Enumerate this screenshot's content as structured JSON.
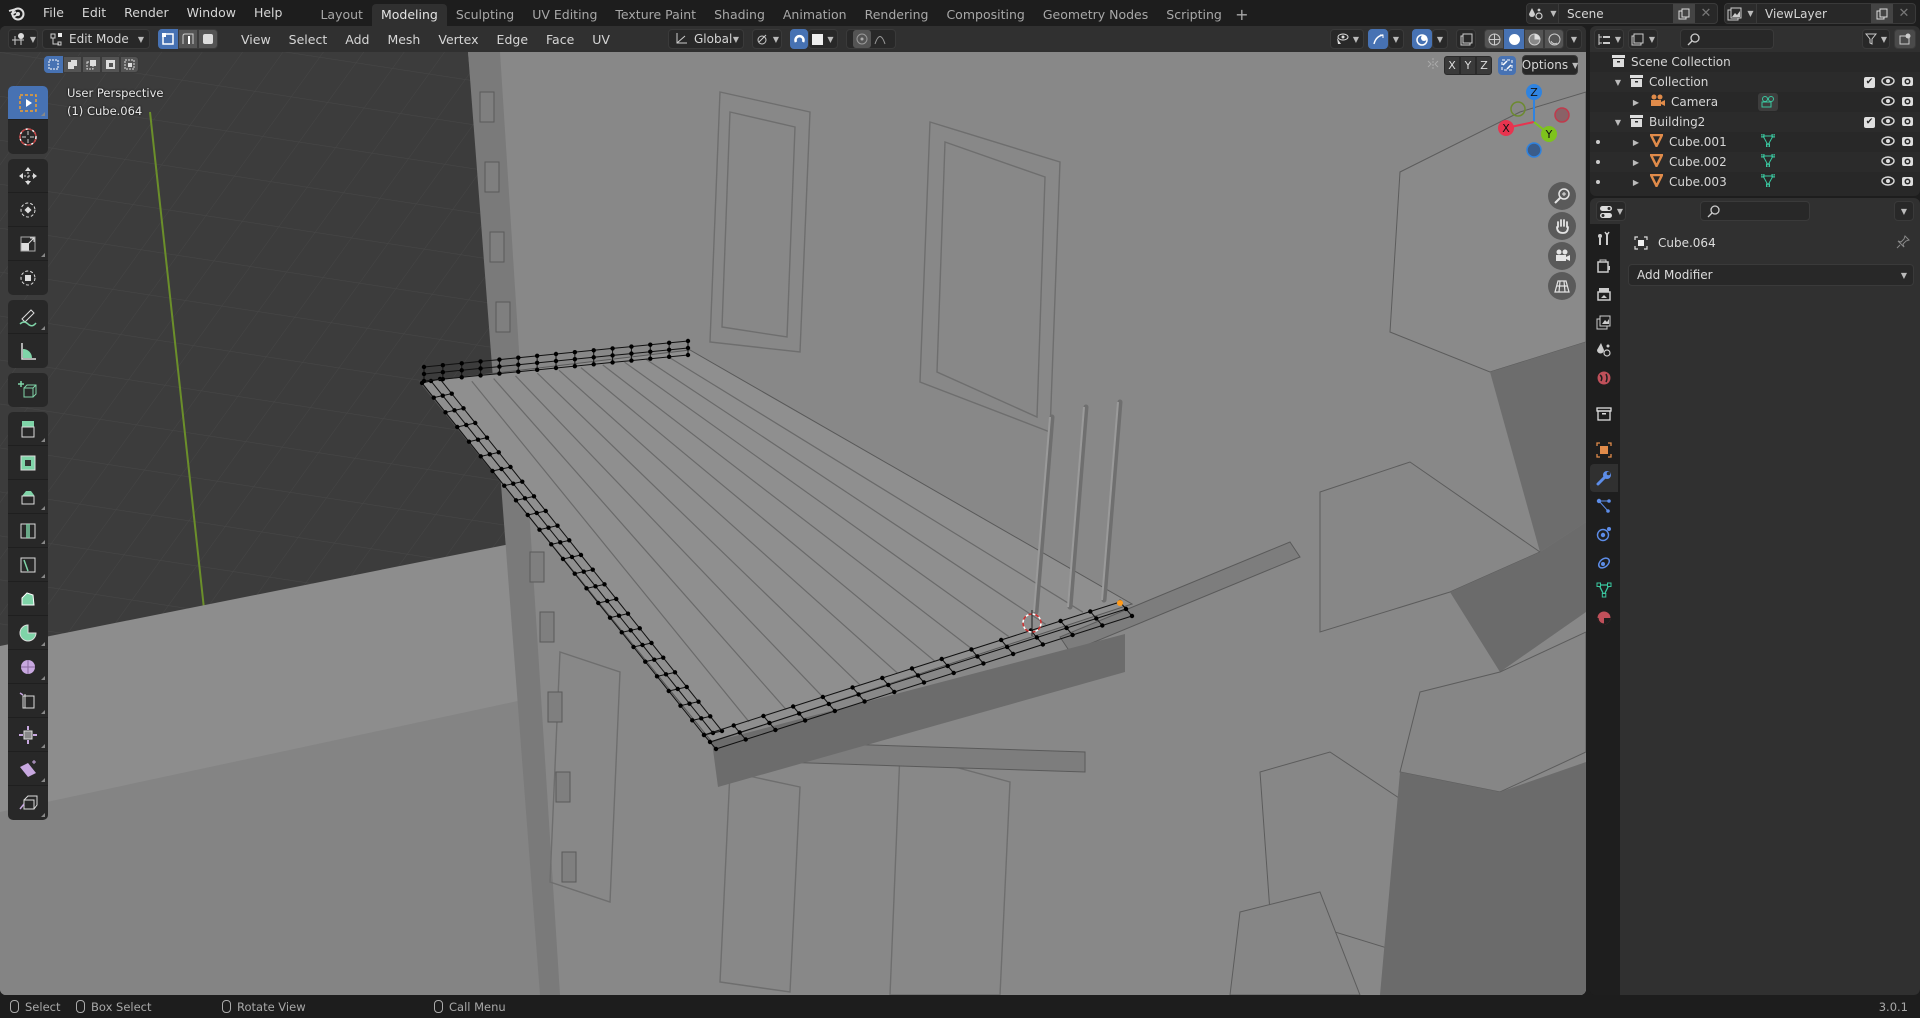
{
  "app": {
    "menus": [
      "File",
      "Edit",
      "Render",
      "Window",
      "Help"
    ],
    "workspaces": [
      "Layout",
      "Modeling",
      "Sculpting",
      "UV Editing",
      "Texture Paint",
      "Shading",
      "Animation",
      "Rendering",
      "Compositing",
      "Geometry Nodes",
      "Scripting"
    ],
    "active_workspace": "Modeling",
    "add_workspace": "+",
    "scene_name": "Scene",
    "view_layer_name": "ViewLayer",
    "version": "3.0.1"
  },
  "viewport_header": {
    "mode": "Edit Mode",
    "menus": [
      "View",
      "Select",
      "Add",
      "Mesh",
      "Vertex",
      "Edge",
      "Face",
      "UV"
    ],
    "transform_orientation": "Global",
    "options_label": "Options",
    "axes": [
      "X",
      "Y",
      "Z"
    ],
    "select_mode_active": "vertex",
    "shading_mode_active": "solid"
  },
  "viewport": {
    "view_name": "User Perspective",
    "object_info": "(1) Cube.064",
    "gizmo_axes": {
      "x": "X",
      "y": "Y",
      "z": "Z"
    },
    "colors": {
      "x": "#e8344f",
      "y": "#7ec31c",
      "z": "#2f83e0",
      "background": "#3f3f3f",
      "selection": "#4772b3"
    }
  },
  "toolbar": {
    "tools": [
      "select-box",
      "cursor",
      "move",
      "rotate",
      "scale",
      "transform",
      "annotate",
      "measure",
      "add-cube",
      "extrude-region",
      "inset-faces",
      "bevel",
      "loop-cut",
      "knife",
      "poly-build",
      "spin",
      "smooth",
      "edge-slide",
      "shrink-fatten",
      "shear",
      "rip-region"
    ],
    "active_tool": "select-box"
  },
  "outliner": {
    "root": "Scene Collection",
    "items": [
      {
        "name": "Collection",
        "depth": 1,
        "type": "collection",
        "expanded": true,
        "checked": true
      },
      {
        "name": "Camera",
        "depth": 2,
        "type": "camera",
        "expanded": false
      },
      {
        "name": "Building2",
        "depth": 1,
        "type": "collection",
        "expanded": true,
        "checked": true
      },
      {
        "name": "Cube.001",
        "depth": 2,
        "type": "mesh",
        "expanded": false
      },
      {
        "name": "Cube.002",
        "depth": 2,
        "type": "mesh",
        "expanded": false
      },
      {
        "name": "Cube.003",
        "depth": 2,
        "type": "mesh",
        "expanded": false
      }
    ]
  },
  "properties": {
    "object_name": "Cube.064",
    "add_modifier_label": "Add Modifier",
    "active_tab": "modifiers",
    "tabs": [
      "tool",
      "render",
      "output",
      "view-layer",
      "scene",
      "world",
      "collection",
      "object",
      "modifiers",
      "particles",
      "physics",
      "constraints",
      "data",
      "material"
    ]
  },
  "statusbar": {
    "items": [
      "Select",
      "Box Select",
      "Rotate View",
      "Call Menu"
    ]
  }
}
